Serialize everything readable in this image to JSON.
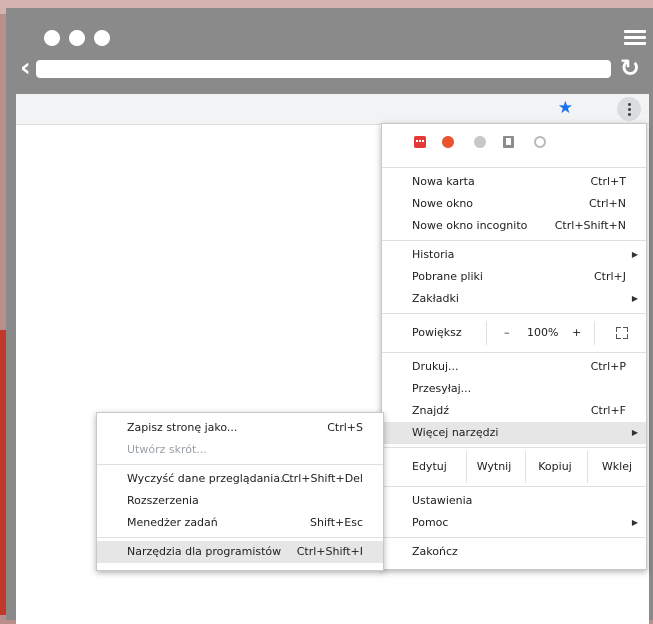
{
  "main_menu": {
    "file_group": [
      {
        "label": "Nowa karta",
        "shortcut": "Ctrl+T"
      },
      {
        "label": "Nowe okno",
        "shortcut": "Ctrl+N"
      },
      {
        "label": "Nowe okno incognito",
        "shortcut": "Ctrl+Shift+N"
      }
    ],
    "history_group": [
      {
        "label": "Historia",
        "shortcut": ""
      },
      {
        "label": "Pobrane pliki",
        "shortcut": "Ctrl+J"
      },
      {
        "label": "Zakładki",
        "shortcut": ""
      }
    ],
    "zoom": {
      "label": "Powiększ",
      "minus": "–",
      "value": "100%",
      "plus": "+"
    },
    "print_group": [
      {
        "label": "Drukuj...",
        "shortcut": "Ctrl+P"
      },
      {
        "label": "Przesyłaj...",
        "shortcut": ""
      },
      {
        "label": "Znajdź",
        "shortcut": "Ctrl+F"
      },
      {
        "label": "Więcej narzędzi",
        "shortcut": ""
      }
    ],
    "edit": {
      "label": "Edytuj",
      "cut": "Wytnij",
      "copy": "Kopiuj",
      "paste": "Wklej"
    },
    "settings_group": [
      {
        "label": "Ustawienia"
      },
      {
        "label": "Pomoc"
      }
    ],
    "quit": {
      "label": "Zakończ"
    }
  },
  "sub_menu": {
    "items_1": [
      {
        "label": "Zapisz stronę jako...",
        "shortcut": "Ctrl+S"
      },
      {
        "label": "Utwórz skrót...",
        "shortcut": ""
      }
    ],
    "items_2": [
      {
        "label": "Wyczyść dane przeglądania...",
        "shortcut": "Ctrl+Shift+Del"
      },
      {
        "label": "Rozszerzenia",
        "shortcut": ""
      },
      {
        "label": "Menedżer zadań",
        "shortcut": "Shift+Esc"
      }
    ],
    "items_3": [
      {
        "label": "Narzędzia dla programistów",
        "shortcut": "Ctrl+Shift+I"
      }
    ]
  },
  "icons": {
    "bookmark_star": "star-icon",
    "menu": "kebab-menu-icon",
    "back": "chevron-left-icon",
    "reload": "reload-icon",
    "window_menu": "hamburger-icon"
  },
  "colors": {
    "accent": "#1a73e8",
    "menu_highlight": "#e6e6e6",
    "frame": "#8a8a8a"
  }
}
